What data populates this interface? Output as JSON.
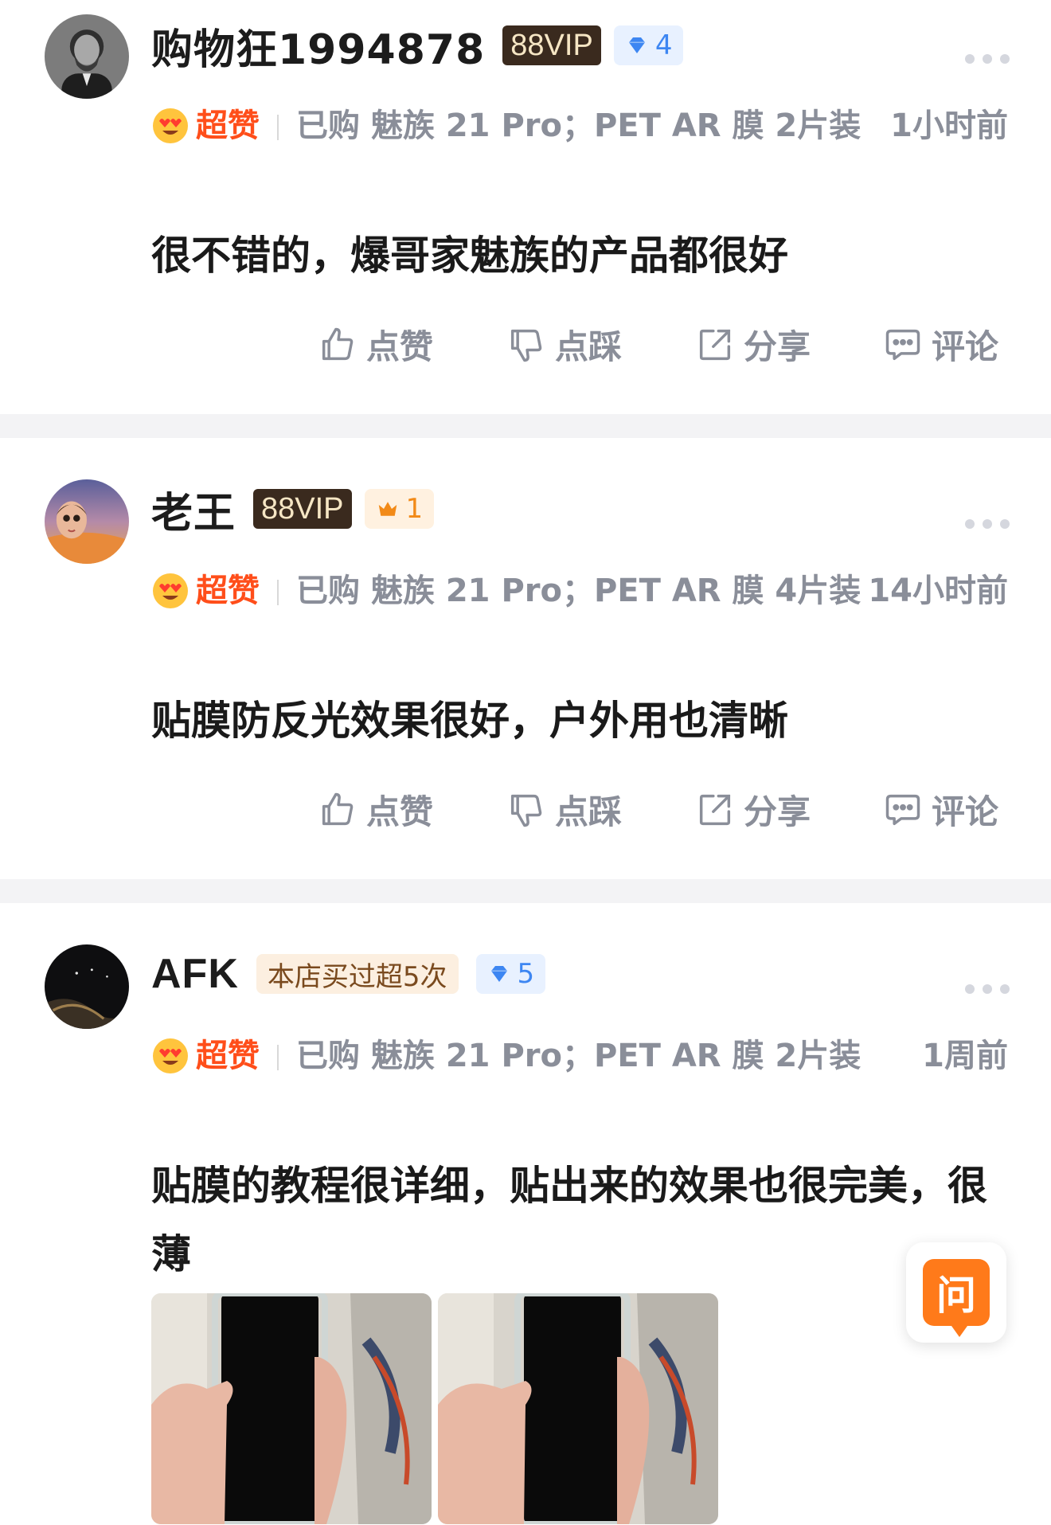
{
  "reviews": [
    {
      "username": "购物狂1994878",
      "vip": "88VIP",
      "badge_type": "diamond",
      "level": "4",
      "rating": "超赞",
      "purchase": "已购 魅族 21 Pro；PET AR 膜 2片装",
      "time": "1小时前",
      "text": "很不错的，爆哥家魅族的产品都很好",
      "actions": {
        "like": "点赞",
        "dislike": "点踩",
        "share": "分享",
        "comment": "评论"
      }
    },
    {
      "username": "老王",
      "vip": "88VIP",
      "badge_type": "crown",
      "level": "1",
      "rating": "超赞",
      "purchase": "已购 魅族 21 Pro；PET AR 膜 4片装",
      "time": "14小时前",
      "text": "贴膜防反光效果很好，户外用也清晰",
      "actions": {
        "like": "点赞",
        "dislike": "点踩",
        "share": "分享",
        "comment": "评论"
      }
    },
    {
      "username": "AFK",
      "shop_badge": "本店买过超5次",
      "badge_type": "diamond",
      "level": "5",
      "rating": "超赞",
      "purchase": "已购 魅族 21 Pro；PET AR 膜 2片装",
      "time": "1周前",
      "text": "贴膜的教程很详细，贴出来的效果也很完美，很薄"
    }
  ],
  "ask_button": "问",
  "colors": {
    "rating": "#ff4e1a",
    "meta_text": "#8a8e99",
    "diamond_badge": "#3d86f2",
    "crown_badge": "#f28a18",
    "ask_button": "#ff7a1a"
  }
}
